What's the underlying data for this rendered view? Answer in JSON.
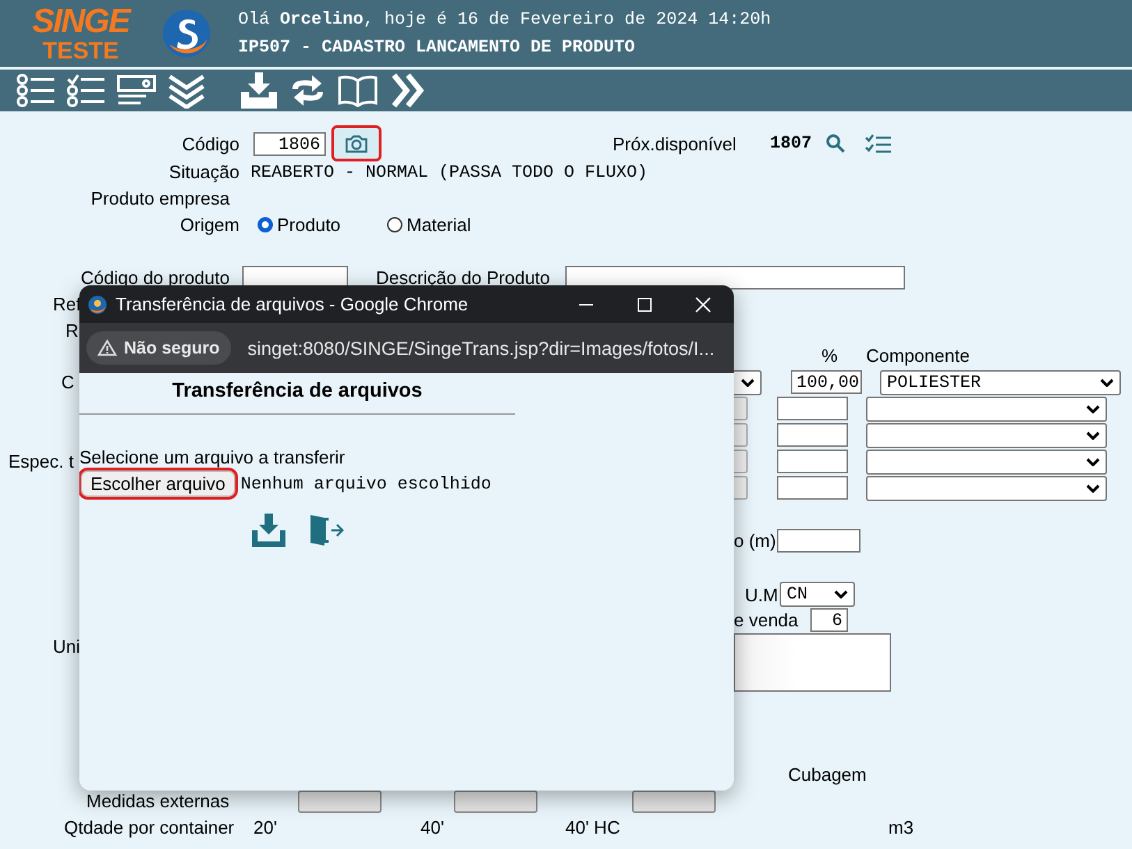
{
  "header": {
    "logo_top": "SINGE",
    "logo_bottom": "TESTE",
    "greeting": "Olá **Orcelino**, hoje é 16 de Fevereiro de 2024 14:20h",
    "screen_title": "IP507 - CADASTRO LANCAMENTO DE PRODUTO"
  },
  "form": {
    "codigo": {
      "label": "Código",
      "value": "1806",
      "photo_highlighted": true
    },
    "proximo": {
      "label": "Próx.disponível",
      "value": "1807"
    },
    "situacao": {
      "label": "Situação",
      "value": "REABERTO - NORMAL (PASSA TODO O FLUXO)"
    },
    "produto_empresa": {
      "label": "Produto empresa"
    },
    "origem": {
      "label": "Origem",
      "options": [
        {
          "label": "Produto",
          "selected": true
        },
        {
          "label": "Material",
          "selected": false
        }
      ]
    },
    "codigo_produto": {
      "label": "Código do produto"
    },
    "descricao": {
      "label": "Descrição do Produto"
    },
    "covered_label_1": {
      "label": "Ref"
    },
    "covered_label_2": {
      "label": "R"
    },
    "composition": {
      "percent_header": "%",
      "component_header": "Componente",
      "rows": [
        {
          "label": "C",
          "percent": "100,00",
          "component": "POLIESTER"
        },
        {},
        {},
        {
          "label": "Espec. t"
        },
        {}
      ]
    },
    "comprimento": {
      "label": "o (m)"
    },
    "um": {
      "label": "U.M",
      "value": "CN"
    },
    "venda": {
      "label": "e venda",
      "value": "6"
    },
    "uni": {
      "label": "Uni"
    },
    "cubagem": {
      "label": "Cubagem"
    },
    "medidas": {
      "label": "Medidas externas"
    },
    "container": {
      "label": "Qtdade por container",
      "columns": [
        "20'",
        "40'",
        "40' HC"
      ],
      "unit": "m3"
    }
  },
  "dialog": {
    "title": "Transferência de arquivos - Google Chrome",
    "security": "Não seguro",
    "url": "singet:8080/SINGE/SingeTrans.jsp?dir=Images/fotos/I...",
    "heading": "Transferência de arquivos",
    "prompt": "Selecione um arquivo a transferir",
    "choose_button": "Escolher arquivo",
    "choose_highlighted": true,
    "no_file": "Nenhum arquivo escolhido"
  }
}
